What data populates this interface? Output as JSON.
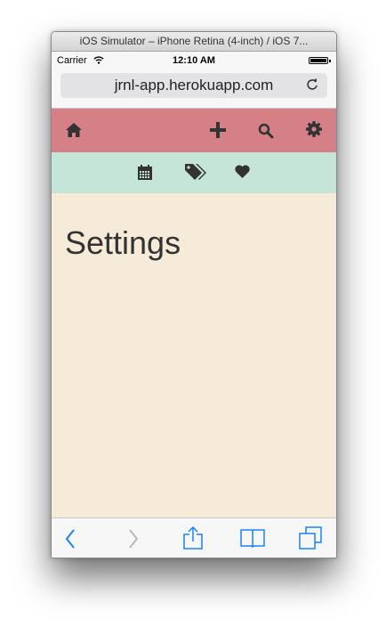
{
  "window": {
    "title": "iOS Simulator – iPhone Retina (4-inch) / iOS 7..."
  },
  "status_bar": {
    "carrier": "Carrier",
    "time": "12:10 AM"
  },
  "browser": {
    "url": "jrnl-app.herokuapp.com"
  },
  "nav": {
    "left_icons": [
      "home-icon"
    ],
    "right_icons": [
      "plus-icon",
      "search-icon",
      "gear-icon"
    ],
    "sub_icons": [
      "calendar-icon",
      "tags-icon",
      "heart-icon"
    ]
  },
  "page": {
    "title": "Settings"
  },
  "toolbar": {
    "icons": [
      "back-icon",
      "forward-icon",
      "share-icon",
      "bookmarks-icon",
      "tabs-icon"
    ]
  },
  "colors": {
    "top_nav": "#d57f86",
    "sub_nav": "#c5e5d9",
    "content_bg": "#f6ead8",
    "toolbar_accent": "#1a82fb"
  }
}
